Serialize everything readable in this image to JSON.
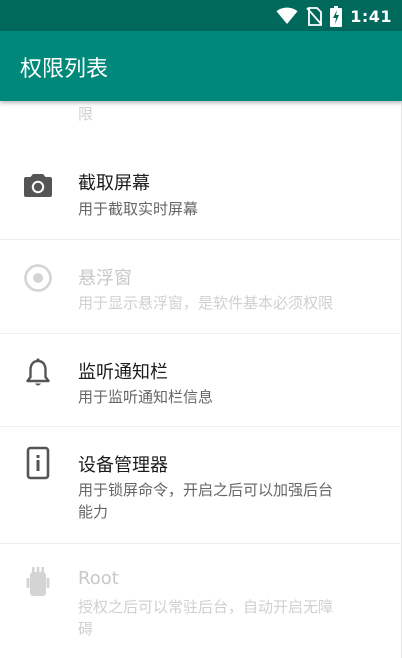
{
  "status_bar": {
    "time": "1:41",
    "icons": [
      "wifi-icon",
      "no-sim-icon",
      "battery-charging-icon"
    ]
  },
  "app_bar": {
    "title": "权限列表"
  },
  "permissions": [
    {
      "title": "",
      "desc": "限",
      "enabled": false,
      "icon": "none"
    },
    {
      "title": "截取屏幕",
      "desc": "用于截取实时屏幕",
      "enabled": true,
      "icon": "camera-icon"
    },
    {
      "title": "悬浮窗",
      "desc": "用于显示悬浮窗，是软件基本必须权限",
      "enabled": false,
      "icon": "radio-target-icon"
    },
    {
      "title": "监听通知栏",
      "desc": "用于监听通知栏信息",
      "enabled": true,
      "icon": "bell-icon"
    },
    {
      "title": "设备管理器",
      "desc_line1": "用于锁屏命令，开启之后可以加强后台",
      "desc_line2": "能力",
      "enabled": true,
      "icon": "device-info-icon"
    },
    {
      "title": "Root",
      "desc_line1": "授权之后可以常驻后台，自动开启无障",
      "desc_line2": "碍",
      "enabled": false,
      "icon": "android-root-icon"
    }
  ],
  "colors": {
    "status_bar": "#00695c",
    "app_bar": "#00897b",
    "icon_enabled": "#555555",
    "icon_disabled": "#d4d4d4"
  }
}
